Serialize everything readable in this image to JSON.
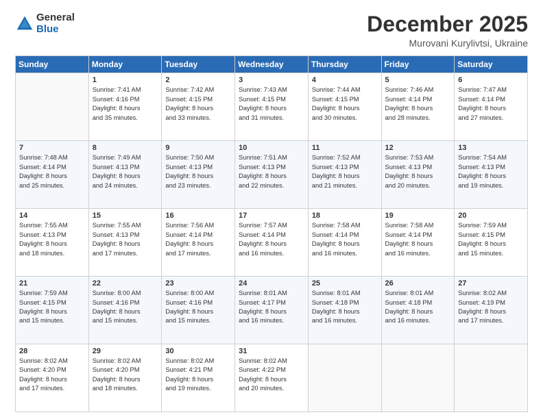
{
  "logo": {
    "general": "General",
    "blue": "Blue"
  },
  "header": {
    "month": "December 2025",
    "location": "Murovani Kurylivtsi, Ukraine"
  },
  "weekdays": [
    "Sunday",
    "Monday",
    "Tuesday",
    "Wednesday",
    "Thursday",
    "Friday",
    "Saturday"
  ],
  "weeks": [
    [
      {
        "day": "",
        "info": ""
      },
      {
        "day": "1",
        "info": "Sunrise: 7:41 AM\nSunset: 4:16 PM\nDaylight: 8 hours\nand 35 minutes."
      },
      {
        "day": "2",
        "info": "Sunrise: 7:42 AM\nSunset: 4:15 PM\nDaylight: 8 hours\nand 33 minutes."
      },
      {
        "day": "3",
        "info": "Sunrise: 7:43 AM\nSunset: 4:15 PM\nDaylight: 8 hours\nand 31 minutes."
      },
      {
        "day": "4",
        "info": "Sunrise: 7:44 AM\nSunset: 4:15 PM\nDaylight: 8 hours\nand 30 minutes."
      },
      {
        "day": "5",
        "info": "Sunrise: 7:46 AM\nSunset: 4:14 PM\nDaylight: 8 hours\nand 28 minutes."
      },
      {
        "day": "6",
        "info": "Sunrise: 7:47 AM\nSunset: 4:14 PM\nDaylight: 8 hours\nand 27 minutes."
      }
    ],
    [
      {
        "day": "7",
        "info": "Sunrise: 7:48 AM\nSunset: 4:14 PM\nDaylight: 8 hours\nand 25 minutes."
      },
      {
        "day": "8",
        "info": "Sunrise: 7:49 AM\nSunset: 4:13 PM\nDaylight: 8 hours\nand 24 minutes."
      },
      {
        "day": "9",
        "info": "Sunrise: 7:50 AM\nSunset: 4:13 PM\nDaylight: 8 hours\nand 23 minutes."
      },
      {
        "day": "10",
        "info": "Sunrise: 7:51 AM\nSunset: 4:13 PM\nDaylight: 8 hours\nand 22 minutes."
      },
      {
        "day": "11",
        "info": "Sunrise: 7:52 AM\nSunset: 4:13 PM\nDaylight: 8 hours\nand 21 minutes."
      },
      {
        "day": "12",
        "info": "Sunrise: 7:53 AM\nSunset: 4:13 PM\nDaylight: 8 hours\nand 20 minutes."
      },
      {
        "day": "13",
        "info": "Sunrise: 7:54 AM\nSunset: 4:13 PM\nDaylight: 8 hours\nand 19 minutes."
      }
    ],
    [
      {
        "day": "14",
        "info": "Sunrise: 7:55 AM\nSunset: 4:13 PM\nDaylight: 8 hours\nand 18 minutes."
      },
      {
        "day": "15",
        "info": "Sunrise: 7:55 AM\nSunset: 4:13 PM\nDaylight: 8 hours\nand 17 minutes."
      },
      {
        "day": "16",
        "info": "Sunrise: 7:56 AM\nSunset: 4:14 PM\nDaylight: 8 hours\nand 17 minutes."
      },
      {
        "day": "17",
        "info": "Sunrise: 7:57 AM\nSunset: 4:14 PM\nDaylight: 8 hours\nand 16 minutes."
      },
      {
        "day": "18",
        "info": "Sunrise: 7:58 AM\nSunset: 4:14 PM\nDaylight: 8 hours\nand 16 minutes."
      },
      {
        "day": "19",
        "info": "Sunrise: 7:58 AM\nSunset: 4:14 PM\nDaylight: 8 hours\nand 16 minutes."
      },
      {
        "day": "20",
        "info": "Sunrise: 7:59 AM\nSunset: 4:15 PM\nDaylight: 8 hours\nand 15 minutes."
      }
    ],
    [
      {
        "day": "21",
        "info": "Sunrise: 7:59 AM\nSunset: 4:15 PM\nDaylight: 8 hours\nand 15 minutes."
      },
      {
        "day": "22",
        "info": "Sunrise: 8:00 AM\nSunset: 4:16 PM\nDaylight: 8 hours\nand 15 minutes."
      },
      {
        "day": "23",
        "info": "Sunrise: 8:00 AM\nSunset: 4:16 PM\nDaylight: 8 hours\nand 15 minutes."
      },
      {
        "day": "24",
        "info": "Sunrise: 8:01 AM\nSunset: 4:17 PM\nDaylight: 8 hours\nand 16 minutes."
      },
      {
        "day": "25",
        "info": "Sunrise: 8:01 AM\nSunset: 4:18 PM\nDaylight: 8 hours\nand 16 minutes."
      },
      {
        "day": "26",
        "info": "Sunrise: 8:01 AM\nSunset: 4:18 PM\nDaylight: 8 hours\nand 16 minutes."
      },
      {
        "day": "27",
        "info": "Sunrise: 8:02 AM\nSunset: 4:19 PM\nDaylight: 8 hours\nand 17 minutes."
      }
    ],
    [
      {
        "day": "28",
        "info": "Sunrise: 8:02 AM\nSunset: 4:20 PM\nDaylight: 8 hours\nand 17 minutes."
      },
      {
        "day": "29",
        "info": "Sunrise: 8:02 AM\nSunset: 4:20 PM\nDaylight: 8 hours\nand 18 minutes."
      },
      {
        "day": "30",
        "info": "Sunrise: 8:02 AM\nSunset: 4:21 PM\nDaylight: 8 hours\nand 19 minutes."
      },
      {
        "day": "31",
        "info": "Sunrise: 8:02 AM\nSunset: 4:22 PM\nDaylight: 8 hours\nand 20 minutes."
      },
      {
        "day": "",
        "info": ""
      },
      {
        "day": "",
        "info": ""
      },
      {
        "day": "",
        "info": ""
      }
    ]
  ]
}
